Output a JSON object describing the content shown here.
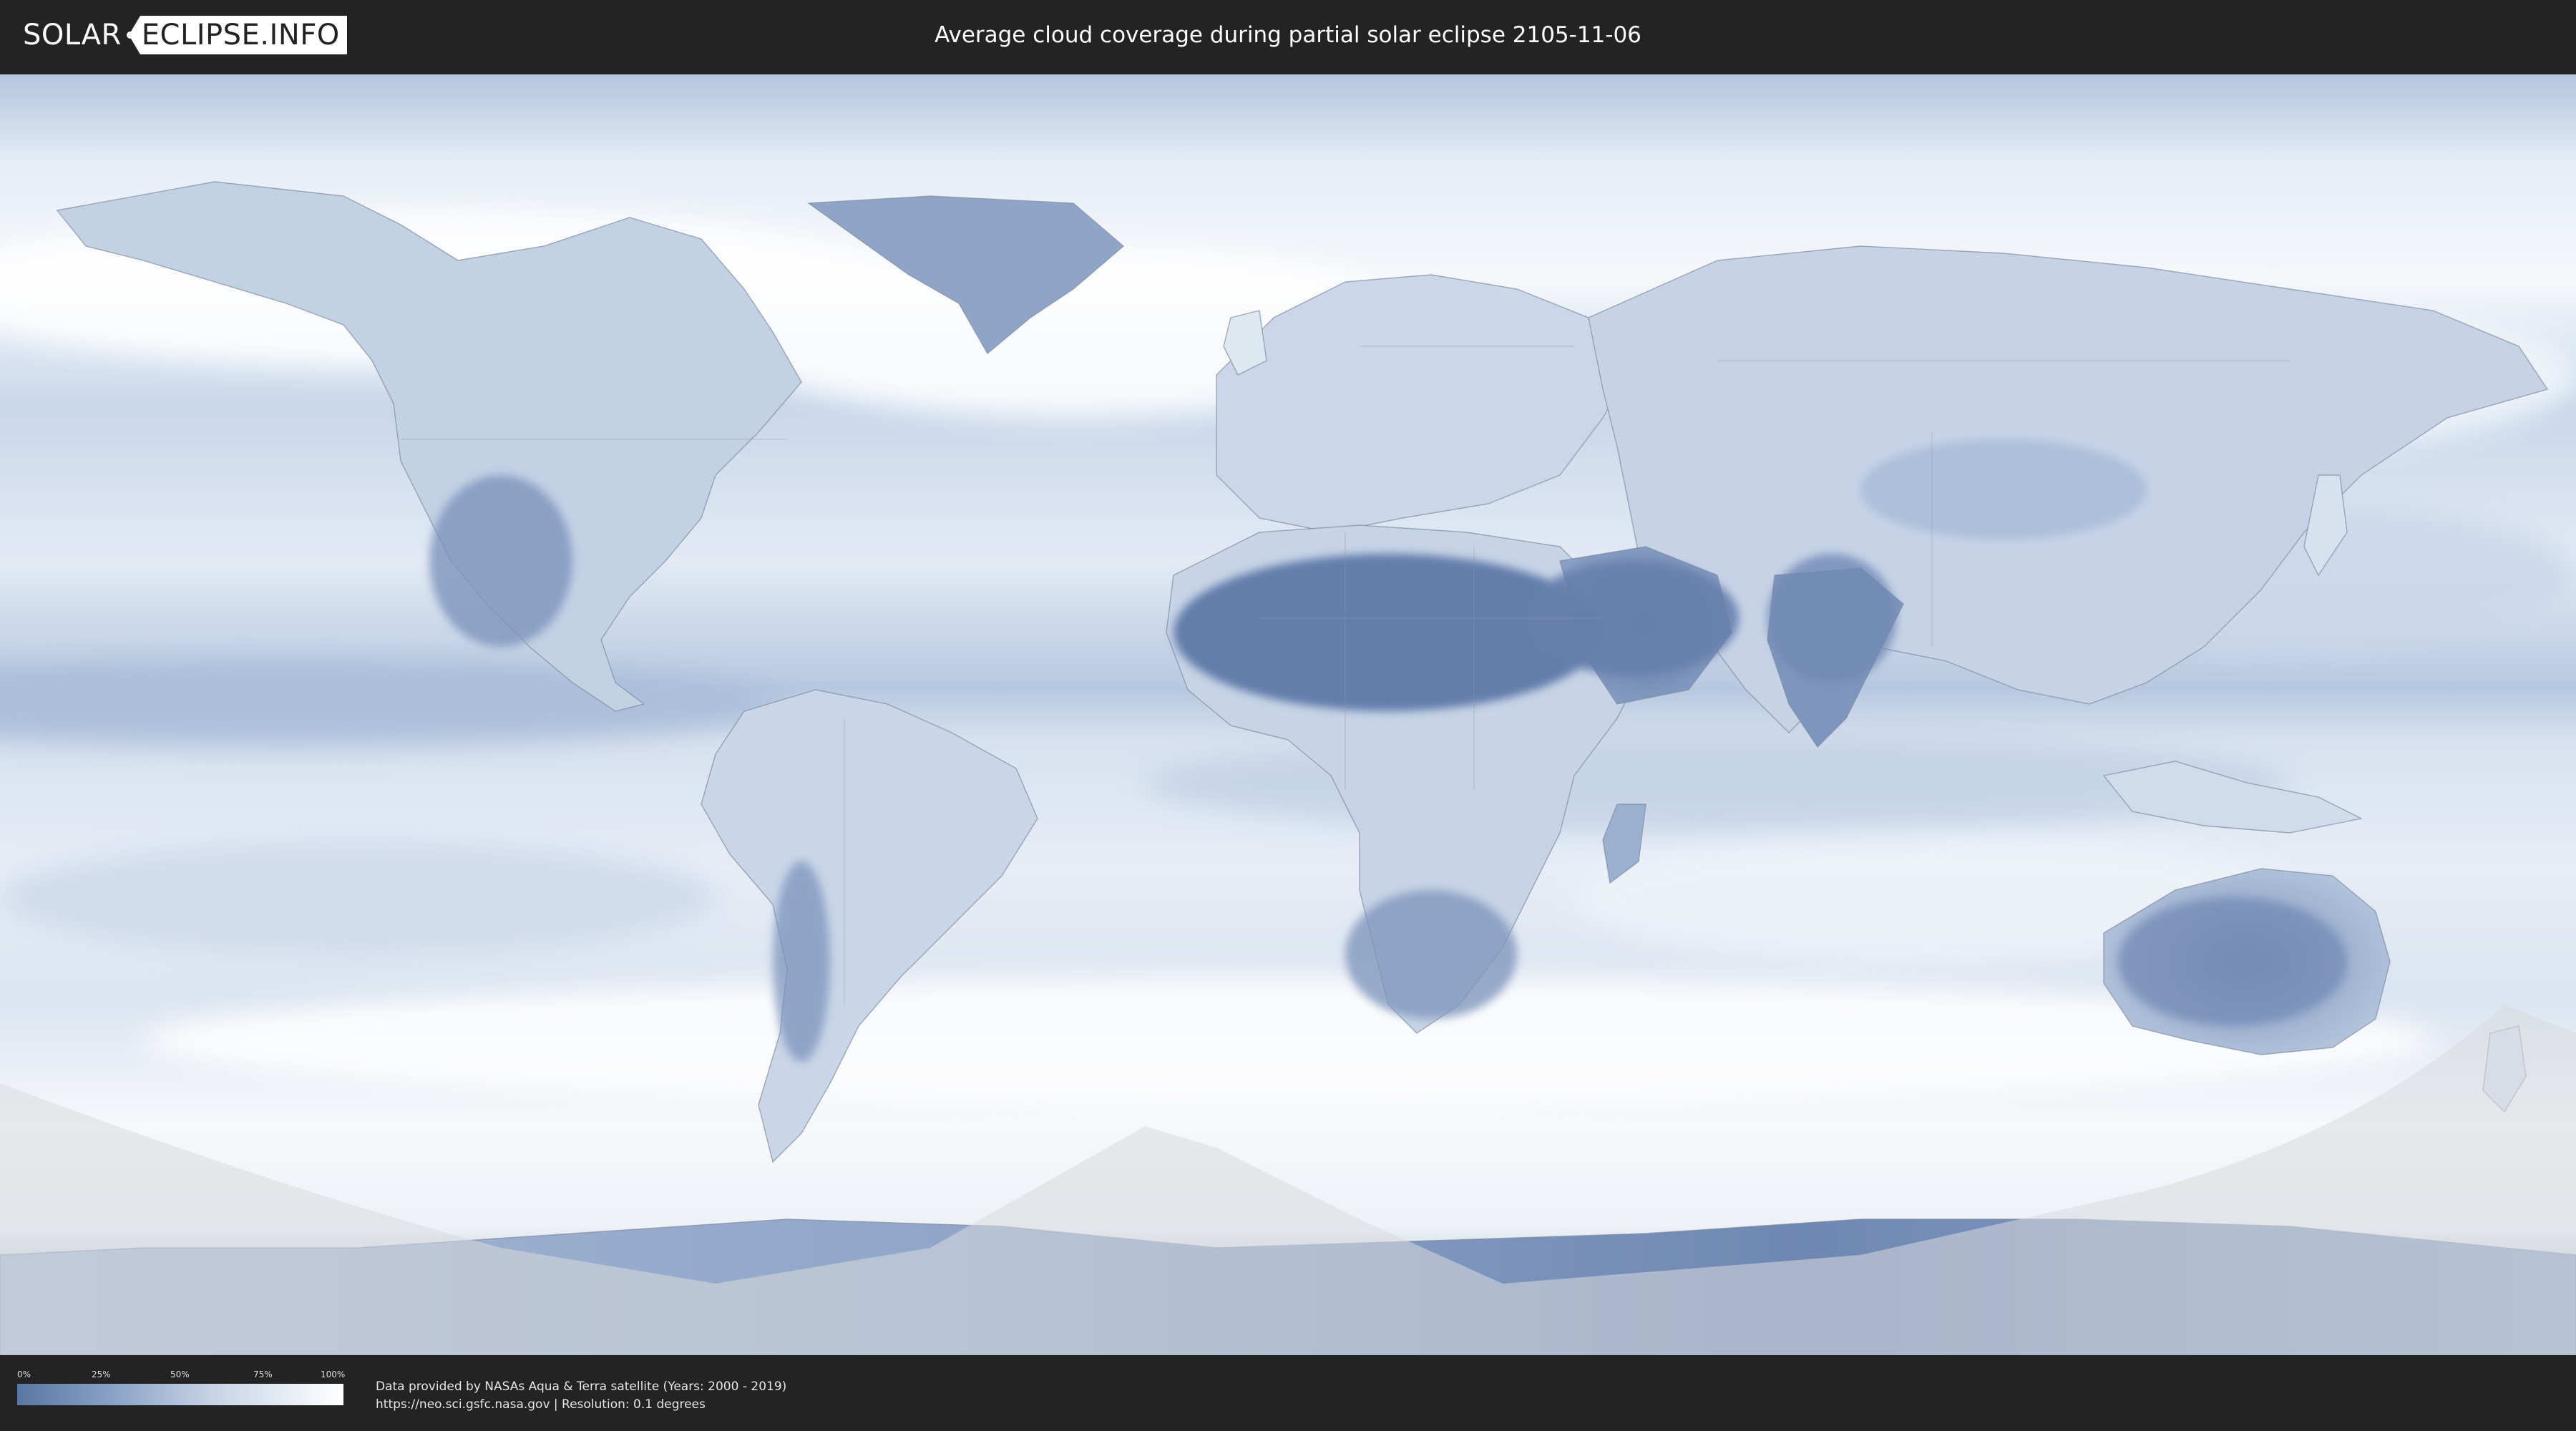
{
  "header": {
    "logo_left": "SOLAR",
    "logo_right": "ECLIPSE.INFO",
    "title": "Average cloud coverage during partial solar eclipse 2105-11-06"
  },
  "map": {
    "subject": "World map, equirectangular projection",
    "eclipse_date": "2105-11-06",
    "colors": {
      "low_cloud": "#5a76a4",
      "mid_cloud": "#a9bcd8",
      "high_cloud": "#f4f7fb",
      "outside_eclipse_shade": "#d8dade",
      "coastline": "#7f8a9c"
    }
  },
  "legend": {
    "ticks": [
      "0%",
      "25%",
      "50%",
      "75%",
      "100%"
    ],
    "colors": {
      "start": "#5a76a4",
      "end": "#ffffff"
    }
  },
  "footer": {
    "line1": "Data provided by NASAs Aqua & Terra satellite (Years: 2000 - 2019)",
    "line2": "https://neo.sci.gsfc.nasa.gov | Resolution: 0.1 degrees"
  }
}
